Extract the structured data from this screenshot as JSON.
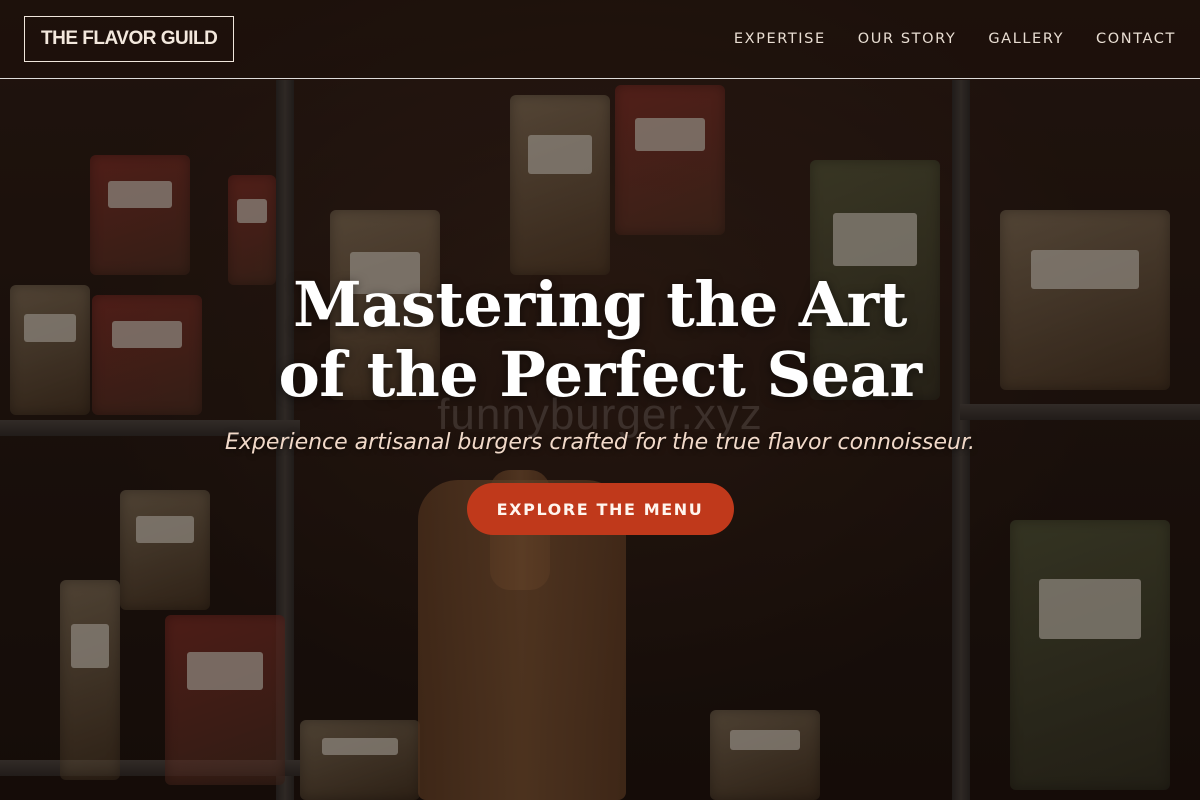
{
  "header": {
    "logo_text": "THE FLAVOR GUILD",
    "nav": [
      {
        "label": "EXPERTISE"
      },
      {
        "label": "OUR STORY"
      },
      {
        "label": "GALLERY"
      },
      {
        "label": "CONTACT"
      }
    ]
  },
  "hero": {
    "title_line1": "Mastering the Art",
    "title_line2": "of the Perfect Sear",
    "subtitle": "Experience artisanal burgers crafted for the true flavor connoisseur.",
    "cta_label": "EXPLORE THE MENU",
    "watermark": "funnyburger.xyz"
  },
  "colors": {
    "accent": "#c0391b",
    "text_light": "#ffffff",
    "subtitle": "#f1d9c9"
  }
}
